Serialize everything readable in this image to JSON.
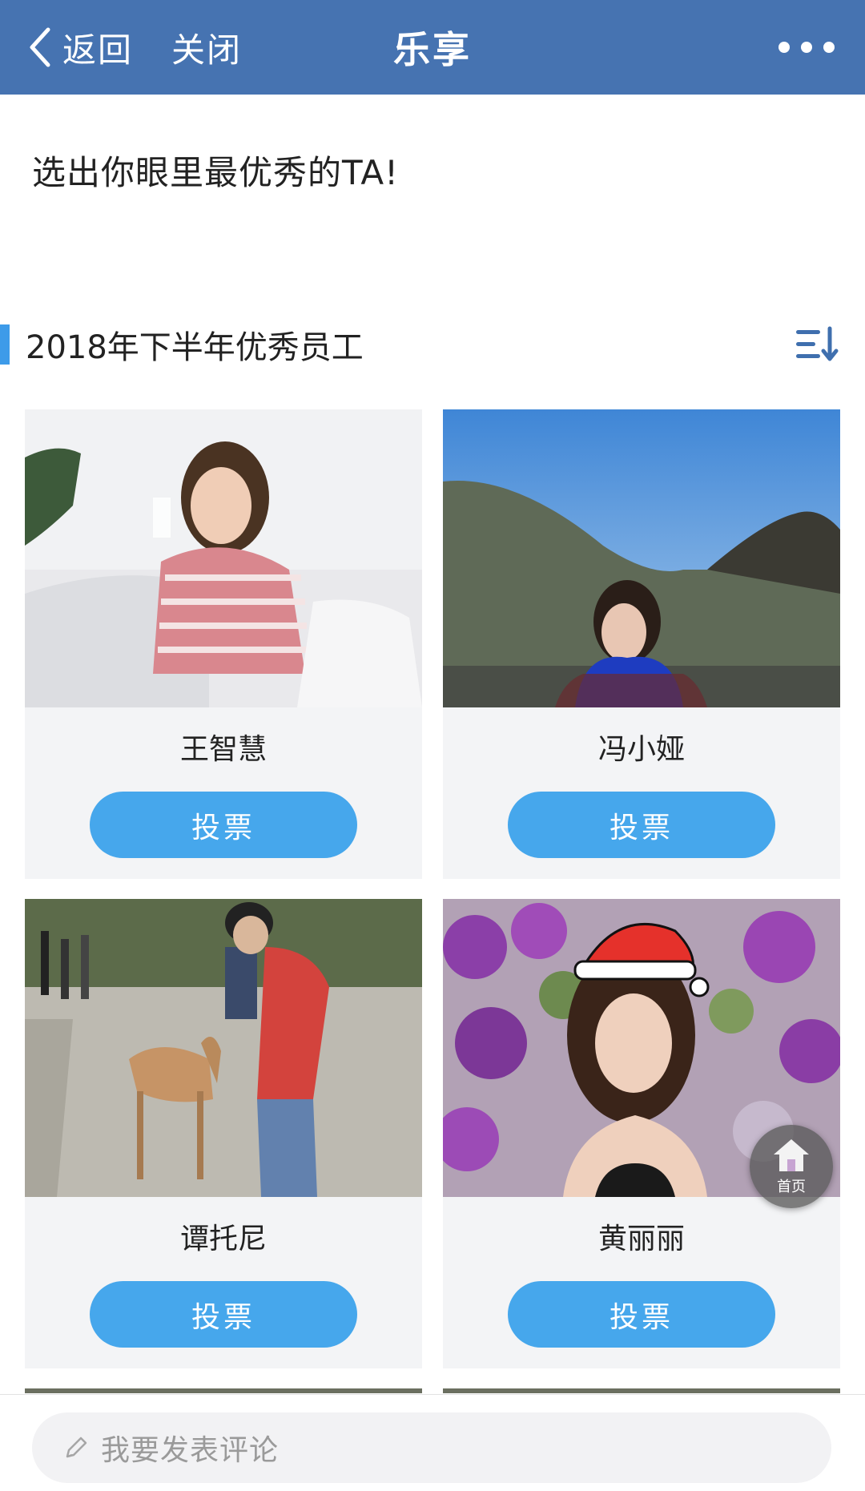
{
  "topbar": {
    "back_label": "返回",
    "close_label": "关闭",
    "title": "乐享",
    "more_icon": "more-dots-icon"
  },
  "intro_text": "选出你眼里最优秀的TA!",
  "section": {
    "title": "2018年下半年优秀员工",
    "sort_icon": "sort-descending-icon"
  },
  "candidates": [
    {
      "name": "王智慧",
      "vote_label": "投票"
    },
    {
      "name": "冯小娅",
      "vote_label": "投票"
    },
    {
      "name": "谭托尼",
      "vote_label": "投票"
    },
    {
      "name": "黄丽丽",
      "vote_label": "投票"
    }
  ],
  "home_button": {
    "label": "首页"
  },
  "comment": {
    "placeholder": "我要发表评论"
  },
  "colors": {
    "topbar": "#4673b1",
    "accent": "#46a7ec",
    "section_marker": "#3d9be9",
    "card_bg": "#f3f4f6"
  }
}
